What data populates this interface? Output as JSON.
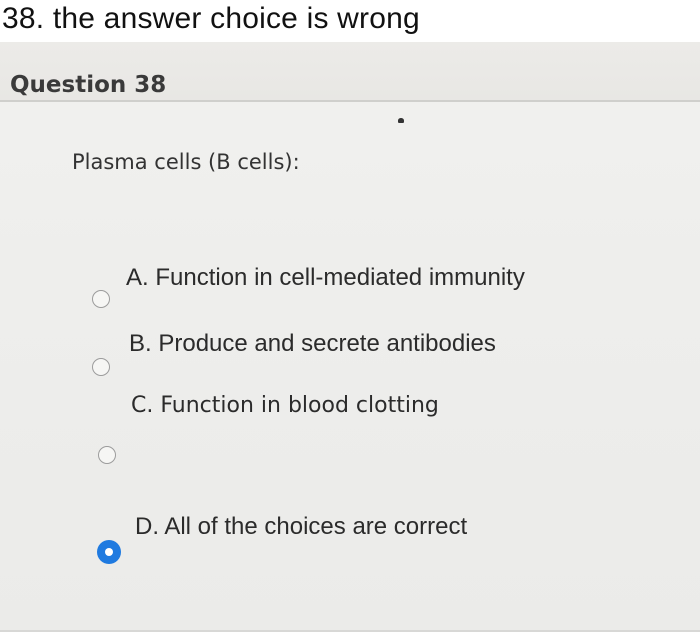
{
  "caption": "38. the answer choice is wrong",
  "question": {
    "title": "Question 38",
    "prompt": "Plasma cells (B cells):",
    "choices": [
      {
        "label": "A. Function in cell-mediated immunity",
        "selected": false
      },
      {
        "label": "B. Produce and secrete antibodies",
        "selected": false
      },
      {
        "label": "C. Function in blood clotting",
        "selected": false
      },
      {
        "label": "D. All of the choices are correct",
        "selected": true
      }
    ]
  },
  "colors": {
    "selected_radio": "#1f7ae0"
  }
}
